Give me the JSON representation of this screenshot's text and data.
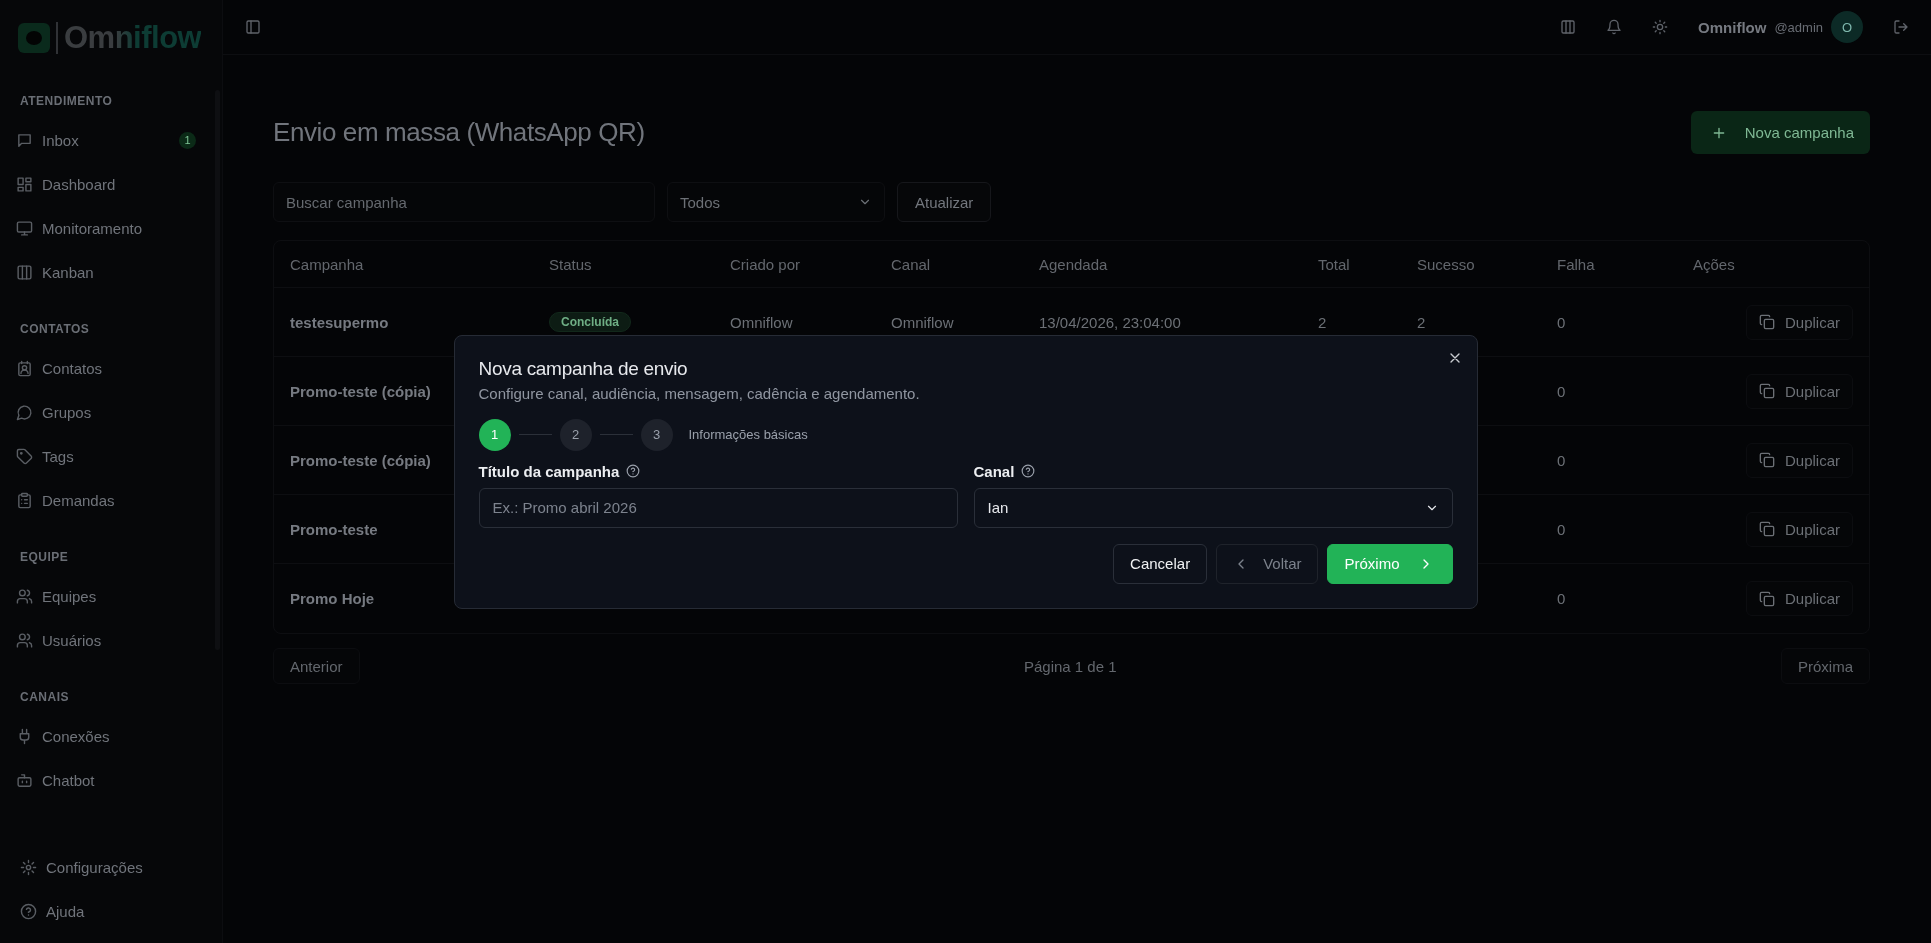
{
  "sidebar": {
    "logo": "Omniflow",
    "sections": [
      {
        "title": "ATENDIMENTO",
        "items": [
          {
            "label": "Inbox",
            "badge": "1"
          },
          {
            "label": "Dashboard"
          },
          {
            "label": "Monitoramento"
          },
          {
            "label": "Kanban"
          }
        ]
      },
      {
        "title": "CONTATOS",
        "items": [
          {
            "label": "Contatos"
          },
          {
            "label": "Grupos"
          },
          {
            "label": "Tags"
          },
          {
            "label": "Demandas"
          }
        ]
      },
      {
        "title": "EQUIPE",
        "items": [
          {
            "label": "Equipes"
          },
          {
            "label": "Usuários"
          }
        ]
      },
      {
        "title": "CANAIS",
        "items": [
          {
            "label": "Conexões"
          },
          {
            "label": "Chatbot"
          }
        ]
      }
    ],
    "footer": [
      {
        "label": "Configurações"
      },
      {
        "label": "Ajuda"
      }
    ]
  },
  "header": {
    "user_name": "Omniflow",
    "user_handle": "@admin",
    "avatar": "O"
  },
  "page": {
    "title": "Envio em massa (WhatsApp QR)",
    "new_button": "Nova campanha",
    "search": {
      "placeholder": "Buscar campanha"
    },
    "filter": "Todos",
    "refresh_button": "Atualizar"
  },
  "table": {
    "columns": [
      "Campanha",
      "Status",
      "Criado por",
      "Canal",
      "Agendada",
      "Total",
      "Sucesso",
      "Falha",
      "Ações"
    ],
    "rows": [
      {
        "campaign": "testesupermo",
        "status": "Concluída",
        "created_by": "Omniflow",
        "channel": "Omniflow",
        "scheduled": "13/04/2026, 23:04:00",
        "total": "2",
        "success": "2",
        "failure": "0",
        "action": "Duplicar"
      },
      {
        "campaign": "Promo-teste (cópia)",
        "failure": "0",
        "action": "Duplicar"
      },
      {
        "campaign": "Promo-teste (cópia)",
        "failure": "0",
        "action": "Duplicar"
      },
      {
        "campaign": "Promo-teste",
        "failure": "0",
        "action": "Duplicar"
      },
      {
        "campaign": "Promo Hoje",
        "failure": "0",
        "action": "Duplicar"
      }
    ]
  },
  "pagination": {
    "previous": "Anterior",
    "info": "Página 1 de 1",
    "next": "Próxima"
  },
  "modal": {
    "title": "Nova campanha de envio",
    "subtitle": "Configure canal, audiência, mensagem, cadência e agendamento.",
    "steps": [
      {
        "label": "1",
        "selected": true
      },
      {
        "label": "2",
        "selected": false
      },
      {
        "label": "3",
        "selected": false
      }
    ],
    "step_title": "Informações básicas",
    "fields": [
      {
        "label": "Título da campanha",
        "kind": "text",
        "placeholder": "Ex.: Promo abril 2026"
      },
      {
        "label": "Canal",
        "kind": "select",
        "value": "Ian"
      }
    ],
    "buttons": [
      {
        "label": "Cancelar",
        "kind": "cancel",
        "disabled": false
      },
      {
        "label": "Voltar",
        "kind": "back",
        "disabled": true
      },
      {
        "label": "Próximo",
        "kind": "next",
        "disabled": false
      }
    ]
  }
}
